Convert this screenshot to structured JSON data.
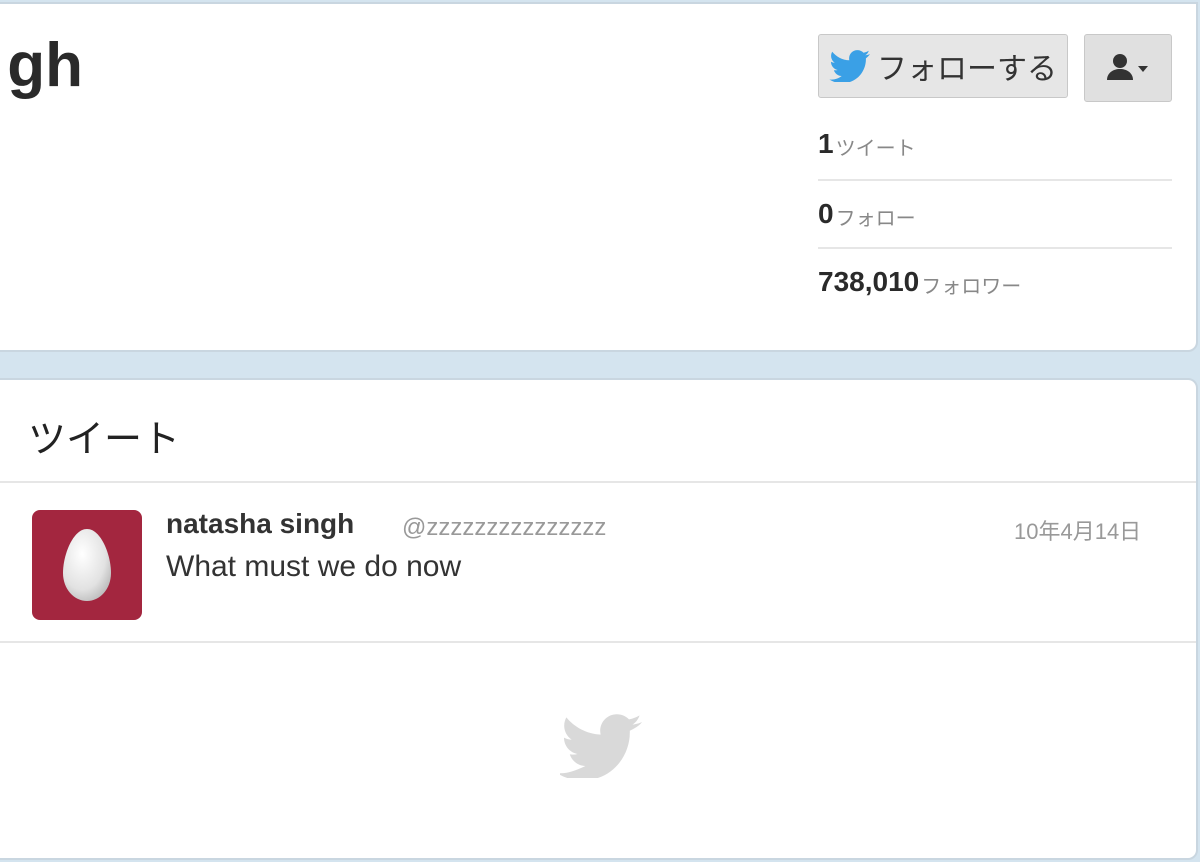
{
  "profile": {
    "name_fragment": "gh"
  },
  "actions": {
    "follow_label": "フォローする",
    "twitter_blue": "#3aa0e6"
  },
  "stats": [
    {
      "value": "1",
      "label": "ツイート"
    },
    {
      "value": "0",
      "label": "フォロー"
    },
    {
      "value": "738,010",
      "label": "フォロワー"
    }
  ],
  "tweets": {
    "heading": "ツイート",
    "items": [
      {
        "name": "natasha singh",
        "handle": "@zzzzzzzzzzzzzzz",
        "date": "10年4月14日",
        "text": "What must we do now",
        "avatar_color": "#a3263f"
      }
    ]
  },
  "icons": {
    "follow": "twitter-bird-icon",
    "user_menu": "user-dropdown-icon",
    "footer": "twitter-bird-icon"
  }
}
